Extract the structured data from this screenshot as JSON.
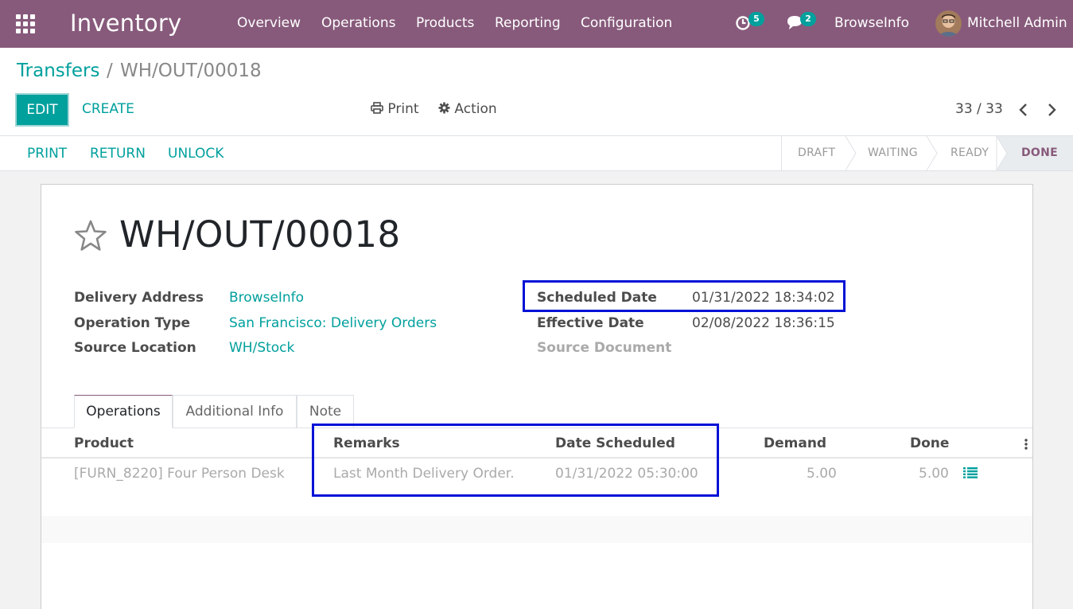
{
  "app": {
    "title": "Inventory"
  },
  "nav": {
    "menus": [
      "Overview",
      "Operations",
      "Products",
      "Reporting",
      "Configuration"
    ],
    "activity_count": "5",
    "message_count": "2",
    "company": "BrowseInfo",
    "user": "Mitchell Admin"
  },
  "breadcrumb": {
    "parent": "Transfers",
    "separator": "/",
    "current": "WH/OUT/00018"
  },
  "control": {
    "edit": "EDIT",
    "create": "CREATE",
    "print": "Print",
    "action": "Action",
    "pager": "33 / 33"
  },
  "statusbar": {
    "buttons": [
      "PRINT",
      "RETURN",
      "UNLOCK"
    ],
    "stages": [
      "DRAFT",
      "WAITING",
      "READY",
      "DONE"
    ],
    "active_stage": "DONE"
  },
  "record": {
    "title": "WH/OUT/00018",
    "left_fields": [
      {
        "label": "Delivery Address",
        "value": "BrowseInfo"
      },
      {
        "label": "Operation Type",
        "value": "San Francisco: Delivery Orders"
      },
      {
        "label": "Source Location",
        "value": "WH/Stock"
      }
    ],
    "right_fields": [
      {
        "label": "Scheduled Date",
        "value": "01/31/2022 18:34:02"
      },
      {
        "label": "Effective Date",
        "value": "02/08/2022 18:36:15"
      },
      {
        "label": "Source Document",
        "value": ""
      }
    ]
  },
  "tabs": [
    "Operations",
    "Additional Info",
    "Note"
  ],
  "table": {
    "columns": [
      "Product",
      "Remarks",
      "Date Scheduled",
      "Demand",
      "Done"
    ],
    "rows": [
      {
        "product": "[FURN_8220] Four Person Desk",
        "remarks": "Last Month Delivery Order.",
        "date_scheduled": "01/31/2022 05:30:00",
        "demand": "5.00",
        "done": "5.00"
      }
    ]
  },
  "colors": {
    "navbar": "#875a7b",
    "accent": "#00a09d",
    "highlight_box": "#0012d6"
  }
}
